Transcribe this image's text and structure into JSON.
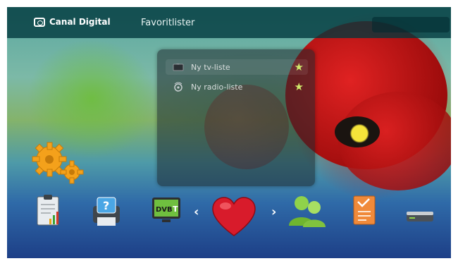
{
  "header": {
    "brand": "Canal Digital",
    "title": "Favoritlister"
  },
  "favorites": {
    "items": [
      {
        "label": "Ny tv-liste",
        "icon": "tv-icon",
        "starred": true
      },
      {
        "label": "Ny radio-liste",
        "icon": "radio-icon",
        "starred": true
      }
    ]
  },
  "dock": {
    "items": [
      "settings-gears-icon",
      "clipboard-chart-icon",
      "help-printer-icon",
      "dvbt-tv-icon",
      "heart-favorites-icon",
      "users-icon",
      "document-icon",
      "receiver-box-icon"
    ],
    "dvbt_text": "DVB-T",
    "nav_left": "‹",
    "nav_right": "›"
  },
  "colors": {
    "header_bg": "#00373c",
    "star": "#cfe86a",
    "heart": "#d81b2b"
  }
}
